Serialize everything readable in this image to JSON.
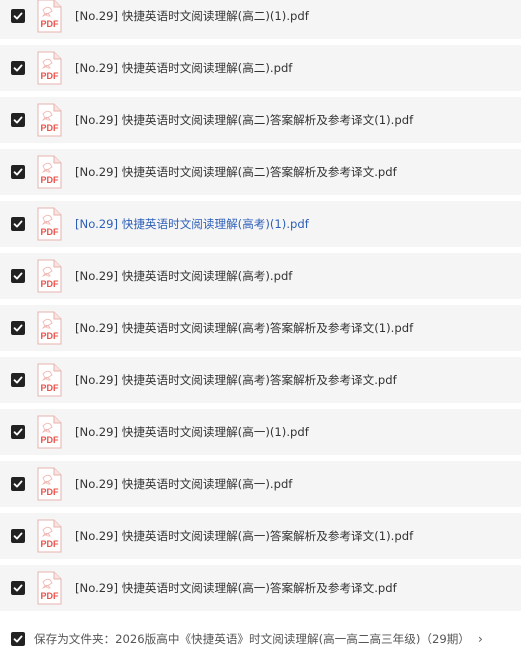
{
  "files": [
    {
      "name": "[No.29] 快捷英语时文阅读理解(高二)(1).pdf",
      "checked": true,
      "active": false,
      "icon": "pdf-icon"
    },
    {
      "name": "[No.29] 快捷英语时文阅读理解(高二).pdf",
      "checked": true,
      "active": false,
      "icon": "pdf-icon"
    },
    {
      "name": "[No.29] 快捷英语时文阅读理解(高二)答案解析及参考译文(1).pdf",
      "checked": true,
      "active": false,
      "icon": "pdf-icon"
    },
    {
      "name": "[No.29] 快捷英语时文阅读理解(高二)答案解析及参考译文.pdf",
      "checked": true,
      "active": false,
      "icon": "pdf-icon"
    },
    {
      "name": "[No.29] 快捷英语时文阅读理解(高考)(1).pdf",
      "checked": true,
      "active": true,
      "icon": "pdf-icon"
    },
    {
      "name": "[No.29] 快捷英语时文阅读理解(高考).pdf",
      "checked": true,
      "active": false,
      "icon": "pdf-icon"
    },
    {
      "name": "[No.29] 快捷英语时文阅读理解(高考)答案解析及参考译文(1).pdf",
      "checked": true,
      "active": false,
      "icon": "pdf-icon"
    },
    {
      "name": "[No.29] 快捷英语时文阅读理解(高考)答案解析及参考译文.pdf",
      "checked": true,
      "active": false,
      "icon": "pdf-icon"
    },
    {
      "name": "[No.29] 快捷英语时文阅读理解(高一)(1).pdf",
      "checked": true,
      "active": false,
      "icon": "pdf-icon"
    },
    {
      "name": "[No.29] 快捷英语时文阅读理解(高一).pdf",
      "checked": true,
      "active": false,
      "icon": "pdf-icon"
    },
    {
      "name": "[No.29] 快捷英语时文阅读理解(高一)答案解析及参考译文(1).pdf",
      "checked": true,
      "active": false,
      "icon": "pdf-icon"
    },
    {
      "name": "[No.29] 快捷英语时文阅读理解(高一)答案解析及参考译文.pdf",
      "checked": true,
      "active": false,
      "icon": "pdf-icon"
    }
  ],
  "pdf_icon_label": "PDF",
  "save": {
    "checked": true,
    "text": "保存为文件夹：2026版高中《快捷英语》时文阅读理解(高一高二高三年级)（29期）",
    "chevron": "›"
  },
  "colors": {
    "row_background": "#f5f5f5",
    "text": "#333333",
    "active_text": "#2d5fb8",
    "pdf_red": "#e8524a",
    "checkbox": "#222222"
  }
}
